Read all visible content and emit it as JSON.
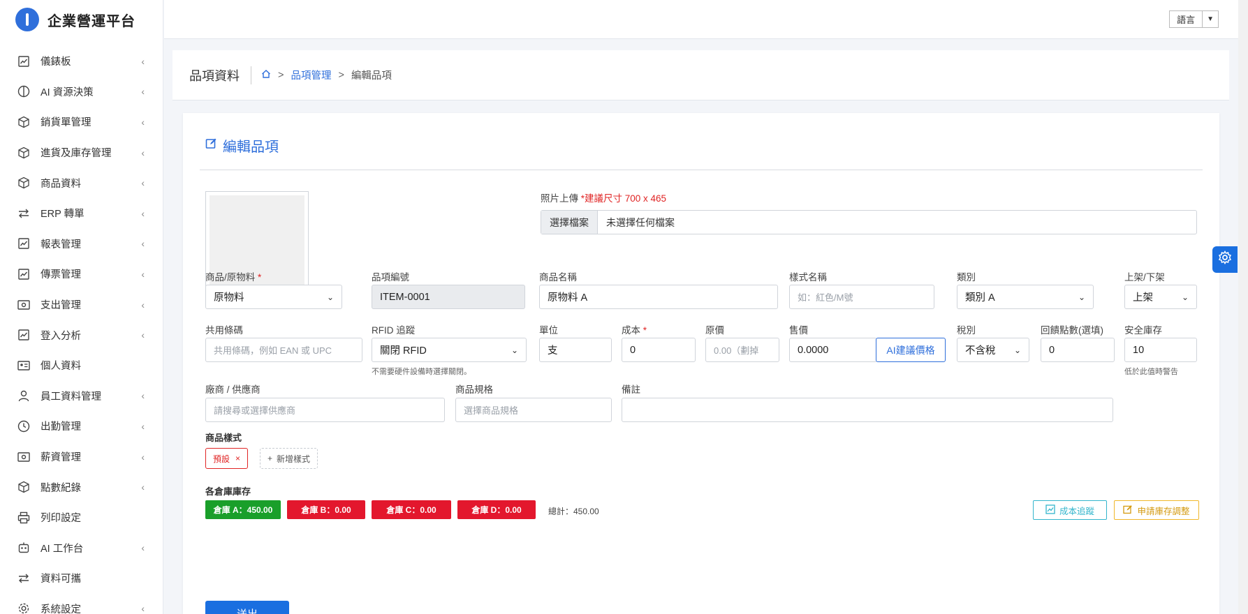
{
  "brand": {
    "title": "企業營運平台"
  },
  "topbar": {
    "language_label": "語言",
    "language_arrow": "▼"
  },
  "sidebar": {
    "items": [
      {
        "label": "儀錶板",
        "icon": "chart-icon",
        "chevron": "‹"
      },
      {
        "label": "AI 資源決策",
        "icon": "brain-icon",
        "chevron": "‹"
      },
      {
        "label": "銷貨單管理",
        "icon": "box-icon",
        "chevron": "‹"
      },
      {
        "label": "進貨及庫存管理",
        "icon": "box-icon",
        "chevron": "‹"
      },
      {
        "label": "商品資料",
        "icon": "box-icon",
        "chevron": "‹"
      },
      {
        "label": "ERP 轉單",
        "icon": "exchange-icon",
        "chevron": "‹"
      },
      {
        "label": "報表管理",
        "icon": "chart-icon",
        "chevron": "‹"
      },
      {
        "label": "傳票管理",
        "icon": "chart-icon",
        "chevron": "‹"
      },
      {
        "label": "支出管理",
        "icon": "money-icon",
        "chevron": "‹"
      },
      {
        "label": "登入分析",
        "icon": "chart-icon",
        "chevron": "‹"
      },
      {
        "label": "個人資料",
        "icon": "id-card-icon",
        "chevron": ""
      },
      {
        "label": "員工資料管理",
        "icon": "user-icon",
        "chevron": "‹"
      },
      {
        "label": "出勤管理",
        "icon": "clock-icon",
        "chevron": "‹"
      },
      {
        "label": "薪資管理",
        "icon": "money-icon",
        "chevron": "‹"
      },
      {
        "label": "點數紀錄",
        "icon": "box-icon",
        "chevron": "‹"
      },
      {
        "label": "列印設定",
        "icon": "printer-icon",
        "chevron": ""
      },
      {
        "label": "AI 工作台",
        "icon": "robot-icon",
        "chevron": "‹"
      },
      {
        "label": "資料可攜",
        "icon": "exchange-icon",
        "chevron": ""
      },
      {
        "label": "系統設定",
        "icon": "gear-icon",
        "chevron": "‹"
      }
    ]
  },
  "header": {
    "page_title": "品項資料",
    "breadcrumb": {
      "home_icon": "home-icon",
      "sep": ">",
      "parent": "品項管理",
      "current": "編輯品項"
    }
  },
  "form": {
    "title": "編輯品項",
    "upload": {
      "label": "照片上傳",
      "hint": "*建議尺寸 700 x 465",
      "button": "選擇檔案",
      "status": "未選擇任何檔案"
    },
    "row1": {
      "type": {
        "label": "商品/原物料",
        "required": "*",
        "value": "原物料"
      },
      "item_no": {
        "label": "品項編號",
        "value": "ITEM-0001"
      },
      "product_name": {
        "label": "商品名稱",
        "value": "原物料 A"
      },
      "style_name": {
        "label": "樣式名稱",
        "placeholder": "如：紅色/M號"
      },
      "category": {
        "label": "類別",
        "value": "類別 A"
      },
      "listing": {
        "label": "上架/下架",
        "value": "上架"
      }
    },
    "row2": {
      "barcode": {
        "label": "共用條碼",
        "placeholder": "共用條碼，例如 EAN 或 UPC"
      },
      "rfid": {
        "label": "RFID 追蹤",
        "value": "關閉 RFID",
        "hint": "不需要硬件設備時選擇關閉。"
      },
      "unit": {
        "label": "單位",
        "value": "支"
      },
      "cost": {
        "label": "成本",
        "required": "*",
        "value": "0"
      },
      "original_price": {
        "label": "原價",
        "placeholder": "0.00（劃掉"
      },
      "price": {
        "label": "售價",
        "value": "0.0000",
        "ai_button": "AI建議價格"
      },
      "tax": {
        "label": "稅別",
        "value": "不含稅"
      },
      "points": {
        "label": "回饋點數(選填)",
        "value": "0"
      },
      "safety_stock": {
        "label": "安全庫存",
        "value": "10",
        "hint": "低於此值時警告"
      }
    },
    "row3": {
      "supplier": {
        "label": "廠商 / 供應商",
        "placeholder": "請搜尋或選擇供應商"
      },
      "spec": {
        "label": "商品規格",
        "placeholder": "選擇商品規格"
      },
      "note": {
        "label": "備註"
      }
    },
    "styles": {
      "label": "商品樣式",
      "default_tag": "預設",
      "remove": "×",
      "add_button": "新增樣式",
      "add_icon": "+"
    },
    "warehouses": {
      "label": "各倉庫庫存",
      "items": [
        {
          "text": "倉庫 A：450.00",
          "status": "green"
        },
        {
          "text": "倉庫 B：0.00",
          "status": "red"
        },
        {
          "text": "倉庫 C：0.00",
          "status": "red"
        },
        {
          "text": "倉庫 D：0.00",
          "status": "red"
        }
      ],
      "total": "總計：450.00",
      "cost_track_button": "成本追蹤",
      "adjust_button": "申請庫存調整"
    },
    "submit_label": "送出"
  },
  "colors": {
    "primary": "#2f6fdb",
    "success": "#1a9f2a",
    "danger": "#e3172d",
    "info": "#33b5cc",
    "warning": "#f0b72a"
  }
}
